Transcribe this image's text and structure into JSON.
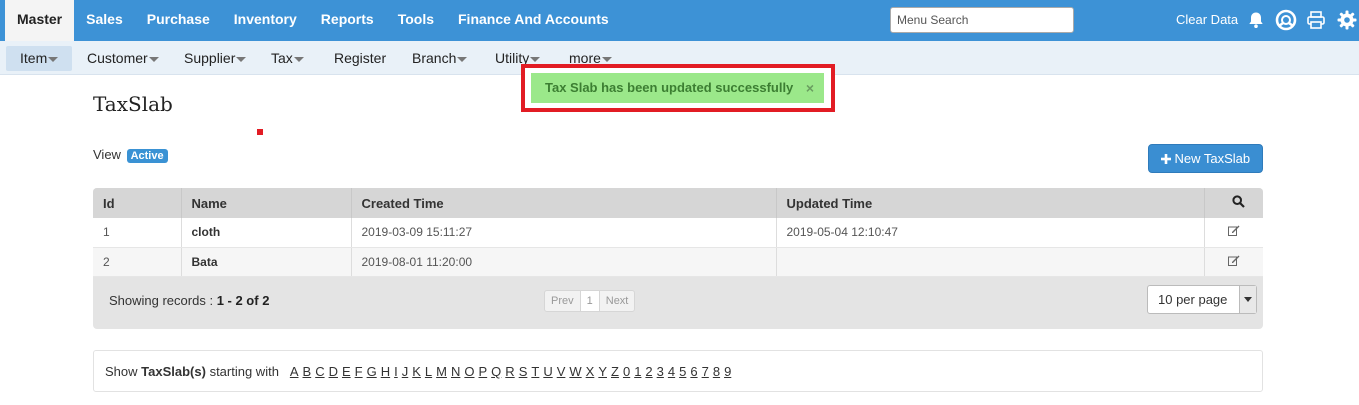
{
  "topnav": {
    "items": [
      {
        "label": "Master",
        "active": true
      },
      {
        "label": "Sales"
      },
      {
        "label": "Purchase"
      },
      {
        "label": "Inventory"
      },
      {
        "label": "Reports"
      },
      {
        "label": "Tools"
      },
      {
        "label": "Finance And Accounts"
      }
    ],
    "search_placeholder": "Menu Search",
    "clear_data": "Clear Data",
    "icons": [
      "bell-icon",
      "support-headset-icon",
      "printer-icon",
      "gear-icon"
    ]
  },
  "subnav": {
    "items": [
      {
        "label": "Item",
        "dropdown": true,
        "active": true
      },
      {
        "label": "Customer",
        "dropdown": true
      },
      {
        "label": "Supplier",
        "dropdown": true
      },
      {
        "label": "Tax",
        "dropdown": true
      },
      {
        "label": "Register",
        "dropdown": false
      },
      {
        "label": "Branch",
        "dropdown": true
      },
      {
        "label": "Utility",
        "dropdown": true
      },
      {
        "label": "more",
        "dropdown": true
      }
    ]
  },
  "toast": {
    "message": "Tax Slab has been updated successfully",
    "close": "×"
  },
  "page": {
    "title": "TaxSlab",
    "view_label": "View",
    "view_badge": "Active",
    "new_button": "New TaxSlab"
  },
  "table": {
    "columns": [
      "Id",
      "Name",
      "Created Time",
      "Updated Time"
    ],
    "rows": [
      {
        "id": "1",
        "name": "cloth",
        "created": "2019-03-09 15:11:27",
        "updated": "2019-05-04 12:10:47"
      },
      {
        "id": "2",
        "name": "Bata",
        "created": "2019-08-01 11:20:00",
        "updated": ""
      }
    ],
    "footer": {
      "showing_label": "Showing records :",
      "range": "1 - 2 of 2",
      "prev": "Prev",
      "page": "1",
      "next": "Next",
      "per_page": "10 per page"
    }
  },
  "alphabet": {
    "prefix": "Show",
    "entity": "TaxSlab(s)",
    "suffix": "starting with",
    "letters": [
      "A",
      "B",
      "C",
      "D",
      "E",
      "F",
      "G",
      "H",
      "I",
      "J",
      "K",
      "L",
      "M",
      "N",
      "O",
      "P",
      "Q",
      "R",
      "S",
      "T",
      "U",
      "V",
      "W",
      "X",
      "Y",
      "Z",
      "0",
      "1",
      "2",
      "3",
      "4",
      "5",
      "6",
      "7",
      "8",
      "9"
    ]
  },
  "colors": {
    "nav": "#3d92d6",
    "accent": "#3a8ed2",
    "toast_bg": "#9be88a",
    "highlight": "#e21c24"
  }
}
